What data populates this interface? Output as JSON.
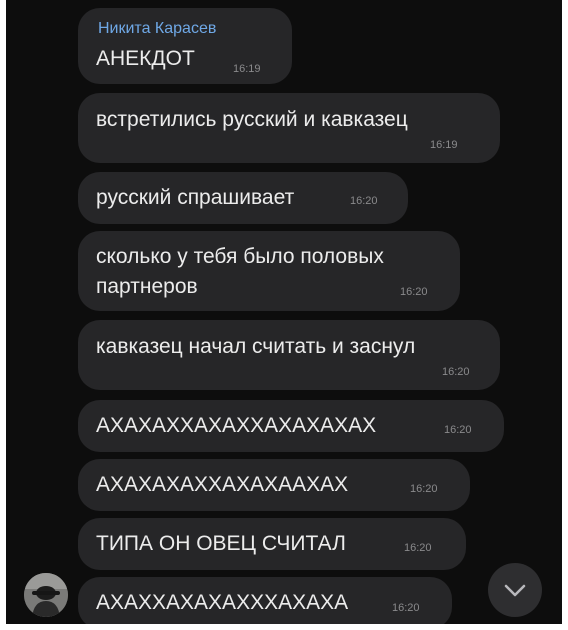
{
  "chat": {
    "sender_name": "Никита Карасев",
    "messages": [
      {
        "text": "АНЕКДОТ",
        "time": "16:19"
      },
      {
        "text": "встретились русский и кавказец",
        "time": "16:19"
      },
      {
        "text": "русский спрашивает",
        "time": "16:20"
      },
      {
        "lines": [
          "сколько у тебя было половых",
          "партнеров"
        ],
        "time": "16:20"
      },
      {
        "text": "кавказец начал считать и заснул",
        "time": "16:20"
      },
      {
        "text": "АХАХАХХАХАХХАХАХАХАХ",
        "time": "16:20"
      },
      {
        "text": "АХАХАХАХХАХАХААХАХ",
        "time": "16:20"
      },
      {
        "text": "ТИПА ОН ОВЕЦ СЧИТАЛ",
        "time": "16:20"
      },
      {
        "text": "АХАХХАХАХАХХХАХАХА",
        "time": "16:20"
      }
    ]
  },
  "icons": {
    "avatar": "user-avatar",
    "scroll": "chevron-down-icon"
  },
  "colors": {
    "background": "#0d0d0d",
    "bubble": "#262628",
    "sender": "#6fa8e6",
    "text": "#ececec",
    "time": "#8a8a8c"
  }
}
